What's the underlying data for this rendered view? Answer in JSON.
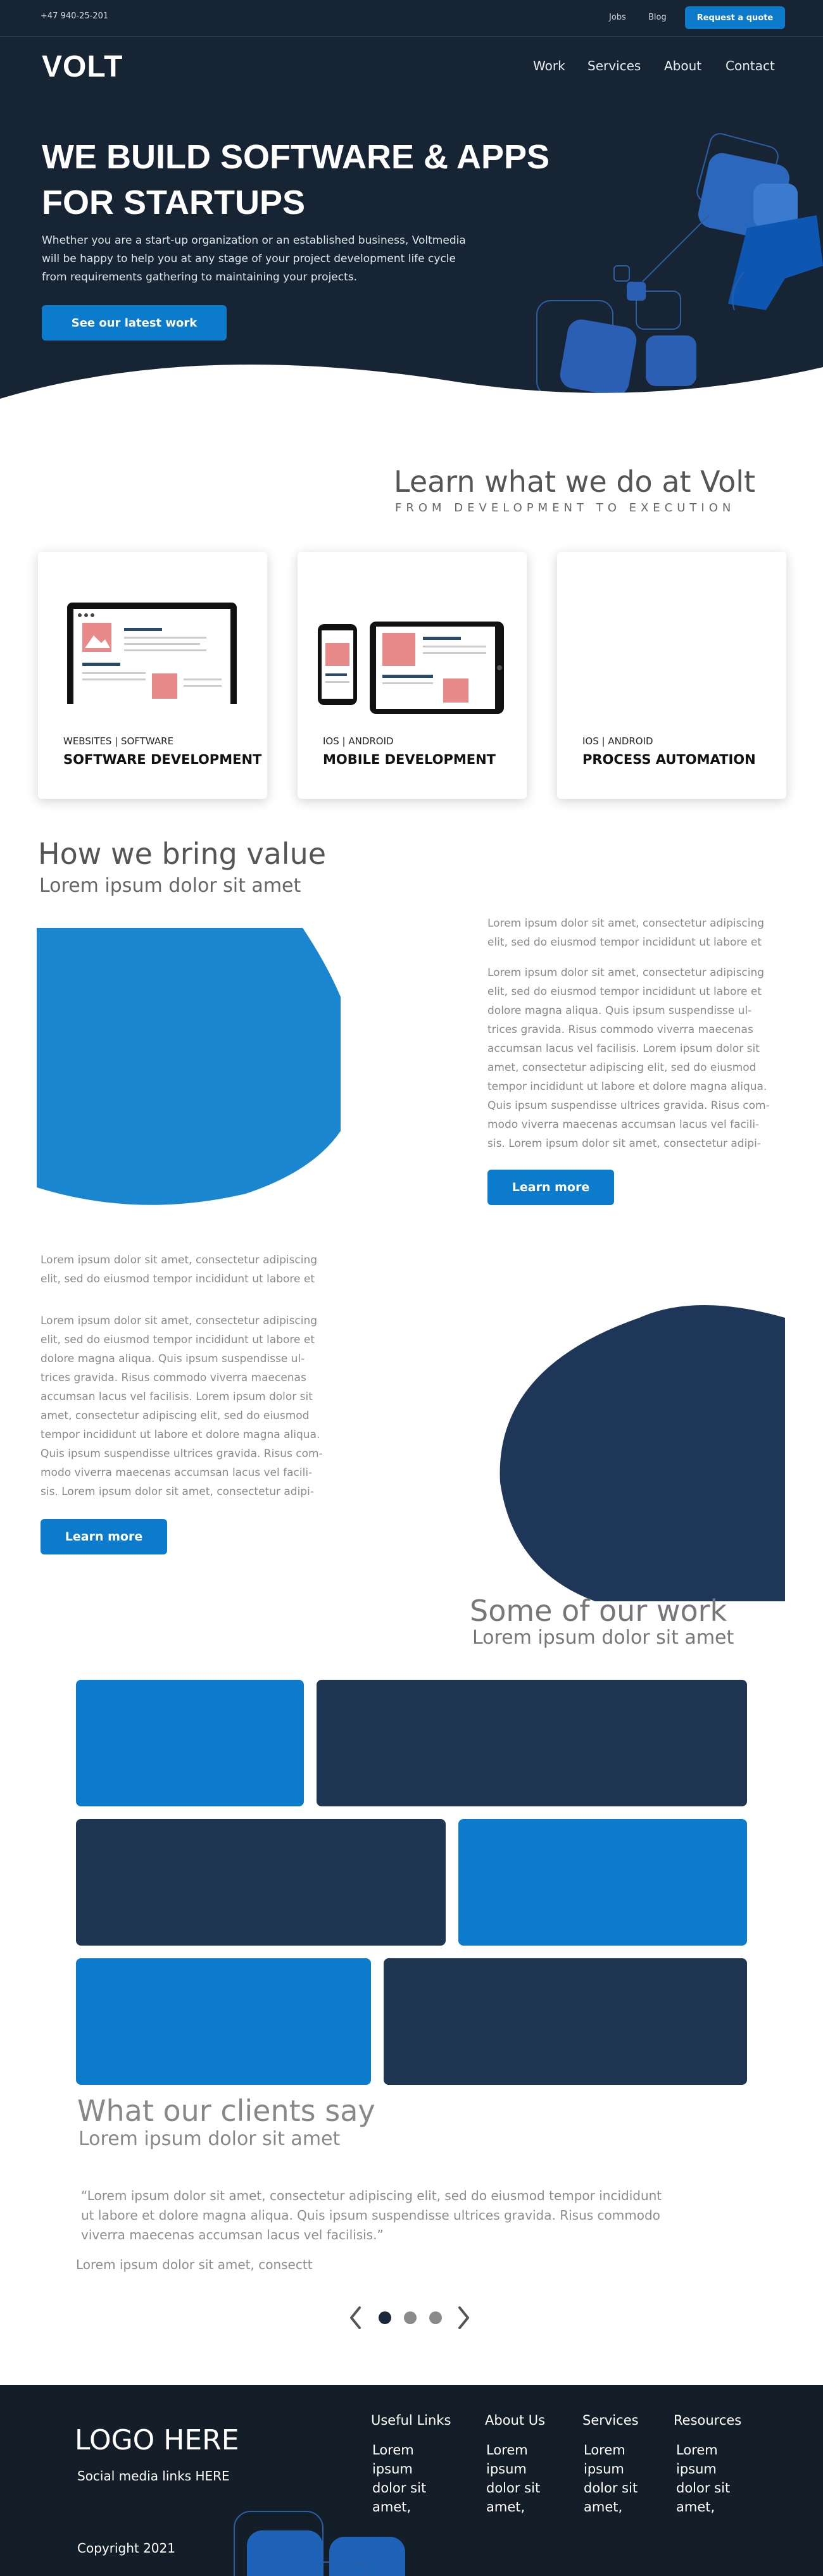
{
  "topbar": {
    "phone": "+47 940-25-201",
    "links": [
      "Jobs",
      "Blog"
    ],
    "quote_button": "Request a quote"
  },
  "header": {
    "logo": "VOLT",
    "nav": [
      "Work",
      "Services",
      "About",
      "Contact"
    ]
  },
  "hero": {
    "title_line1": "WE BUILD SOFTWARE & APPS",
    "title_line2": "FOR STARTUPS",
    "subtitle_line1": "Whether you are a start-up organization or an established business, Voltmedia",
    "subtitle_line2": "will be happy to help you at any stage of your project development life cycle",
    "subtitle_line3": "from requirements gathering to maintaining your projects.",
    "cta": "See our latest work"
  },
  "services": {
    "title": "Learn what we do at Volt",
    "subtitle": "FROM DEVELOPMENT TO EXECUTION",
    "cards": [
      {
        "tag": "WEBSITES  |  SOFTWARE",
        "name": "SOFTWARE DEVELOPMENT"
      },
      {
        "tag": "IOS  |  ANDROID",
        "name": "MOBILE DEVELOPMENT"
      },
      {
        "tag": "IOS  |  ANDROID",
        "name": "PROCESS AUTOMATION"
      }
    ]
  },
  "value": {
    "title": "How we bring value",
    "subtitle": "Lorem ipsum dolor sit amet",
    "block1": {
      "intro": [
        "Lorem ipsum dolor sit amet, consectetur adipiscing",
        "elit, sed do eiusmod tempor incididunt ut labore et"
      ],
      "body": [
        "Lorem ipsum dolor sit amet, consectetur adipiscing",
        "elit, sed do eiusmod tempor incididunt ut labore et",
        "dolore magna aliqua. Quis ipsum suspendisse ul-",
        "trices gravida. Risus commodo viverra maecenas",
        "accumsan lacus vel facilisis. Lorem ipsum dolor sit",
        "amet, consectetur adipiscing elit, sed do eiusmod",
        "tempor incididunt ut labore et dolore magna aliqua.",
        "Quis ipsum suspendisse ultrices gravida. Risus com-",
        "modo viverra maecenas accumsan lacus vel facili-",
        "sis. Lorem ipsum dolor sit amet, consectetur adipi-"
      ],
      "button": "Learn more"
    },
    "block2": {
      "intro": [
        "Lorem ipsum dolor sit amet, consectetur adipiscing",
        "elit, sed do eiusmod tempor incididunt ut labore et"
      ],
      "body": [
        "Lorem ipsum dolor sit amet, consectetur adipiscing",
        "elit, sed do eiusmod tempor incididunt ut labore et",
        "dolore magna aliqua. Quis ipsum suspendisse ul-",
        "trices gravida. Risus commodo viverra maecenas",
        "accumsan lacus vel facilisis. Lorem ipsum dolor sit",
        "amet, consectetur adipiscing elit, sed do eiusmod",
        "tempor incididunt ut labore et dolore magna aliqua.",
        "Quis ipsum suspendisse ultrices gravida. Risus com-",
        "modo viverra maecenas accumsan lacus vel facili-",
        "sis. Lorem ipsum dolor sit amet, consectetur adipi-"
      ],
      "button": "Learn more"
    }
  },
  "work": {
    "title": "Some of our work",
    "subtitle": "Lorem ipsum dolor sit amet"
  },
  "testimonials": {
    "title": "What our clients say",
    "subtitle": "Lorem ipsum dolor sit amet",
    "quote": [
      "“Lorem ipsum dolor sit amet, consectetur adipiscing elit, sed do eiusmod tempor incididunt",
      "ut labore et dolore magna aliqua. Quis ipsum suspendisse ultrices gravida. Risus commodo",
      "viverra maecenas accumsan lacus vel facilisis.”"
    ],
    "author": "Lorem ipsum dolor sit amet, consectt",
    "prev_icon": "chevron-left-icon",
    "next_icon": "chevron-right-icon"
  },
  "footer": {
    "logo": "LOGO HERE",
    "social": "Social media links HERE",
    "copyright": "Copyright  2021",
    "columns": [
      {
        "heading": "Useful Links",
        "body": "Lorem ipsum dolor sit amet, consecte-"
      },
      {
        "heading": "About Us",
        "body": "Lorem ipsum dolor sit amet, consecte-"
      },
      {
        "heading": "Services",
        "body": "Lorem ipsum dolor sit amet, consecte-"
      },
      {
        "heading": "Resources",
        "body": "Lorem ipsum dolor sit amet, consecte-"
      }
    ]
  },
  "colors": {
    "primary_blue": "#0d7bcb",
    "hero_navy": "#172433",
    "tile_navy": "#1f3652",
    "footer_bg": "#131e29"
  }
}
